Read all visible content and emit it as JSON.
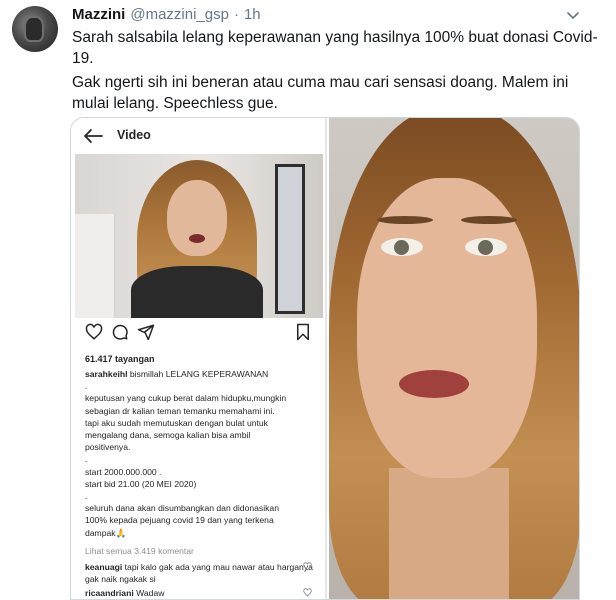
{
  "tweet": {
    "name": "Mazzini",
    "handle": "@mazzini_gsp",
    "separator": "·",
    "time": "1h",
    "paragraphs": [
      "Sarah salsabila lelang keperawanan yang hasilnya 100% buat donasi Covid-19.",
      "Gak ngerti sih ini beneran atau cuma mau cari sensasi doang. Malem ini mulai lelang. Speechless gue."
    ]
  },
  "instagram": {
    "title": "Video",
    "views": "61.417 tayangan",
    "caption_user": "sarahkeihl",
    "caption_first": "bismillah LELANG KEPERAWANAN",
    "caption_lines": [
      ".",
      "keputusan yang cukup berat dalam hidupku,mungkin",
      "sebagian dr kalian teman temanku memahami ini.",
      "tapi aku sudah memutuskan dengan bulat untuk",
      "mengalang dana, semoga kalian bisa ambil",
      "positivenya.",
      ".",
      "start 2000.000.000 .",
      "start bid 21.00 (20 MEI 2020)",
      ".",
      "seluruh dana akan disumbangkan dan didonasikan",
      "100% kepada pejuang covid 19 dan yang terkena",
      "dampak🙏"
    ],
    "view_comments": "Lihat semua 3.419 komentar",
    "comments": [
      {
        "user": "keanuagi",
        "text": "tapi kalo gak ada yang mau nawar atau harganya gak naik ngakak si"
      },
      {
        "user": "ricaandriani",
        "text": "Wadaw"
      }
    ]
  },
  "icons": {
    "avatar": "avatar",
    "chevron": "chevron-down-icon",
    "back": "back-arrow-icon",
    "like": "heart-icon",
    "comment": "comment-icon",
    "share": "share-icon",
    "save": "bookmark-icon"
  },
  "colors": {
    "secondary_text": "#657786",
    "border": "#cfd9de"
  }
}
